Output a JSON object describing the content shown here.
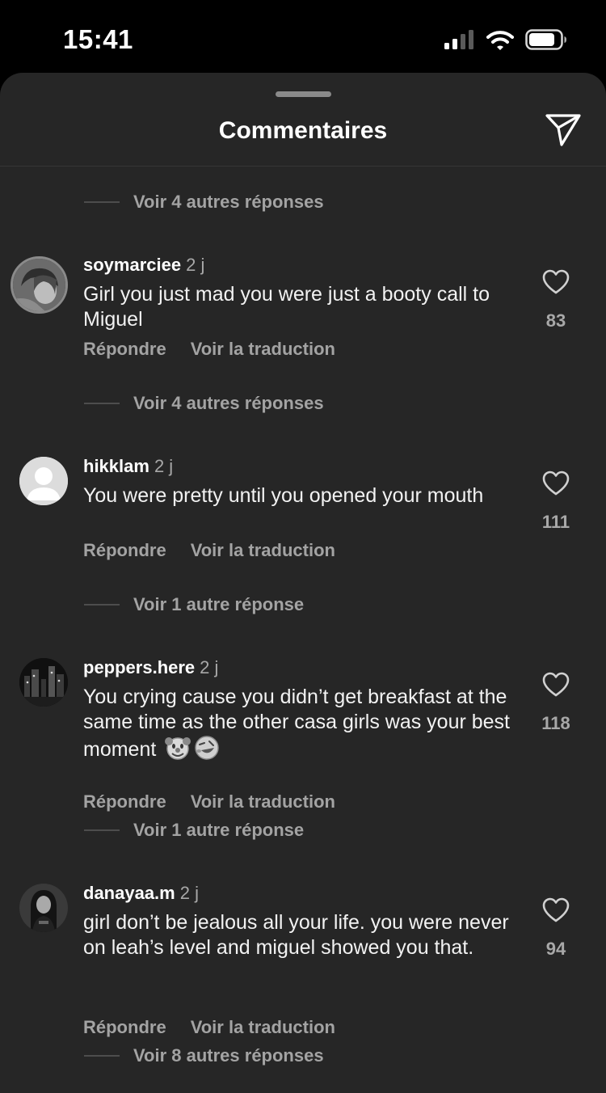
{
  "status_bar": {
    "time": "15:41"
  },
  "sheet": {
    "title": "Commentaires"
  },
  "reply_threads": [
    "Voir 4 autres réponses",
    "Voir 4 autres réponses",
    "Voir 1 autre réponse",
    "Voir 1 autre réponse",
    "Voir 8 autres réponses"
  ],
  "comments": [
    {
      "username": "soymarciee",
      "time": "2 j",
      "text": "Girl you just mad you were just a booty call to Miguel",
      "likes": "83",
      "reply_label": "Répondre",
      "translate_label": "Voir la traduction"
    },
    {
      "username": "hikklam",
      "time": "2 j",
      "text": "You were pretty until you opened your mouth",
      "likes": "111",
      "reply_label": "Répondre",
      "translate_label": "Voir la traduction"
    },
    {
      "username": "peppers.here",
      "time": "2 j",
      "text": "You crying cause you didn’t get breakfast at the same time as the other casa girls was your best moment",
      "emojis": [
        "clown-face-emoji",
        "rolling-laughing-emoji"
      ],
      "likes": "118",
      "reply_label": "Répondre",
      "translate_label": "Voir la traduction"
    },
    {
      "username": "danayaa.m",
      "time": "2 j",
      "text": "girl don’t be jealous all your life. you were never on leah’s level and miguel showed you that.",
      "likes": "94",
      "reply_label": "Répondre",
      "translate_label": "Voir la traduction"
    }
  ],
  "icons": {
    "status": [
      "signal-icon",
      "wifi-icon",
      "battery-icon"
    ],
    "share": "paper-plane-icon",
    "like": "heart-outline-icon"
  },
  "colors": {
    "background": "#262626",
    "muted_text": "#a3a3a3",
    "primary_text": "#f2f2f2"
  }
}
